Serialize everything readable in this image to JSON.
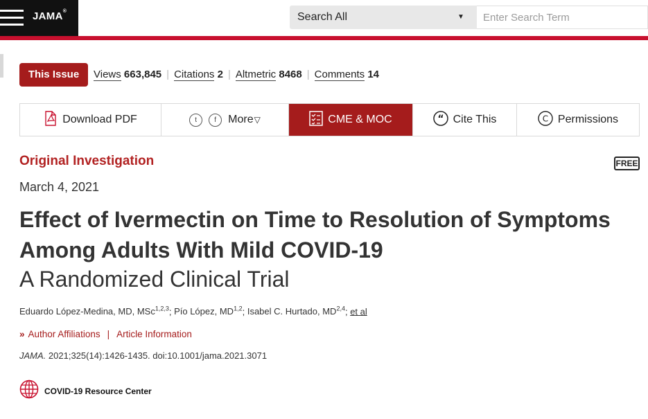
{
  "header": {
    "logo": "JAMA",
    "logo_mark": "®",
    "search_scope": "Search All",
    "search_placeholder": "Enter Search Term"
  },
  "metrics": {
    "issue_button": "This Issue",
    "views_label": "Views",
    "views_value": "663,845",
    "citations_label": "Citations",
    "citations_value": "2",
    "altmetric_label": "Altmetric",
    "altmetric_value": "8468",
    "comments_label": "Comments",
    "comments_value": "14",
    "separator": "|"
  },
  "toolbar": {
    "download_pdf": "Download PDF",
    "more": "More",
    "cme_moc": "CME & MOC",
    "cite_this": "Cite This",
    "permissions": "Permissions",
    "twitter_glyph": "t",
    "facebook_glyph": "f",
    "copyright_glyph": "C"
  },
  "article": {
    "section": "Original Investigation",
    "access_badge": "FREE",
    "date": "March 4, 2021",
    "title": "Effect of Ivermectin on Time to Resolution of Symptoms Among Adults With Mild COVID-19",
    "subtitle": "A Randomized Clinical Trial",
    "authors": [
      {
        "name": "Eduardo López-Medina, MD, MSc",
        "sup": "1,2,3"
      },
      {
        "name": "Pío López, MD",
        "sup": "1,2"
      },
      {
        "name": "Isabel C. Hurtado, MD",
        "sup": "2,4"
      }
    ],
    "et_al": "et al",
    "author_affiliations": "Author Affiliations",
    "article_information": "Article Information",
    "journal": "JAMA.",
    "citation": "2021;325(14):1426-1435. doi:10.1001/jama.2021.3071",
    "resource_center": "COVID-19 Resource Center"
  },
  "colors": {
    "brand_red": "#c8102e",
    "button_red": "#a51c1c",
    "section_red": "#b22222"
  }
}
